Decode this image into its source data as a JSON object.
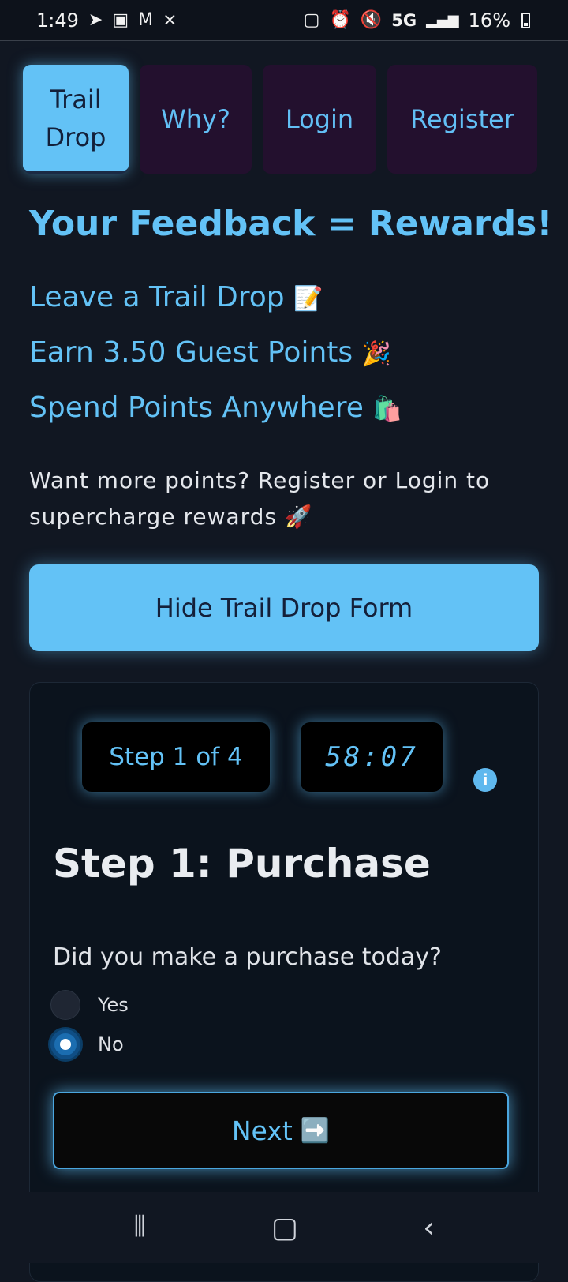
{
  "status_bar": {
    "time": "1:49",
    "network": "5G",
    "battery": "16%",
    "left_icons": [
      "telegram-icon",
      "calendar-icon",
      "gmail-icon",
      "app-icon"
    ],
    "right_icons": [
      "nfc-icon",
      "alarm-icon",
      "mute-icon",
      "signal-icon",
      "battery-icon"
    ]
  },
  "nav": {
    "tabs": [
      {
        "label": "Trail Drop",
        "active": true
      },
      {
        "label": "Why?"
      },
      {
        "label": "Login"
      },
      {
        "label": "Register"
      }
    ]
  },
  "hero": {
    "headline": "Your Feedback = Rewards!",
    "bullets": [
      {
        "text": "Leave a Trail Drop",
        "emoji": "📝"
      },
      {
        "text": "Earn 3.50 Guest Points",
        "emoji": "🎉"
      },
      {
        "text": "Spend Points Anywhere",
        "emoji": "🛍️"
      }
    ],
    "promo": "Want more points? Register or Login to supercharge rewards",
    "promo_emoji": "🚀"
  },
  "hide_button": "Hide Trail Drop Form",
  "form": {
    "step_badge": "Step 1 of 4",
    "timer": "58:07",
    "info_glyph": "i",
    "step_title": "Step 1: Purchase",
    "question": "Did you make a purchase today?",
    "options": [
      {
        "label": "Yes",
        "checked": false
      },
      {
        "label": "No",
        "checked": true
      }
    ],
    "next_label": "Next",
    "next_emoji": "➡️"
  },
  "colors": {
    "accent": "#63c2f6",
    "background": "#111722",
    "tab_inactive": "#23102e",
    "card": "#0b131d"
  }
}
